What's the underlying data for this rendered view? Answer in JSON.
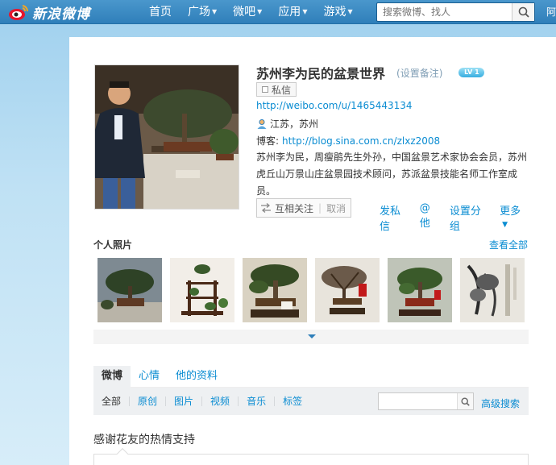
{
  "topbar": {
    "logo_text": "新浪微博",
    "nav": [
      {
        "label": "首页",
        "caret": false
      },
      {
        "label": "广场",
        "caret": true
      },
      {
        "label": "微吧",
        "caret": true
      },
      {
        "label": "应用",
        "caret": true
      },
      {
        "label": "游戏",
        "caret": true
      }
    ],
    "search_placeholder": "搜索微博、找人",
    "right_text": "阿"
  },
  "profile": {
    "name": "苏州李为民的盆景世界",
    "remark_link": "(设置备注)",
    "level_badge": "LV 1",
    "message_button": "私信",
    "weibo_url": "http://weibo.com/u/1465443134",
    "location": "江苏，苏州",
    "blog_label": "博客:",
    "blog_url": "http://blog.sina.com.cn/zlxz2008",
    "bio": "苏州李为民，周瘦鹃先生外孙，中国盆景艺术家协会会员，苏州虎丘山万景山庄盆景园技术顾问，苏派盆景技能名师工作室成员。",
    "follow_status": "互相关注",
    "follow_cancel": "取消",
    "actions": {
      "send_message": "发私信",
      "at_him": "@他",
      "set_group": "设置分组",
      "more": "更多"
    }
  },
  "photos": {
    "title": "个人照片",
    "view_all": "查看全部"
  },
  "feed": {
    "tabs": [
      "微博",
      "心情",
      "他的资料"
    ],
    "filters": [
      "全部",
      "原创",
      "图片",
      "视频",
      "音乐",
      "标签"
    ],
    "advanced_search": "高级搜索",
    "post_text": "感谢花友的热情支持"
  },
  "colors": {
    "link": "#0a8cd2",
    "topbar": "#2f7fba"
  }
}
